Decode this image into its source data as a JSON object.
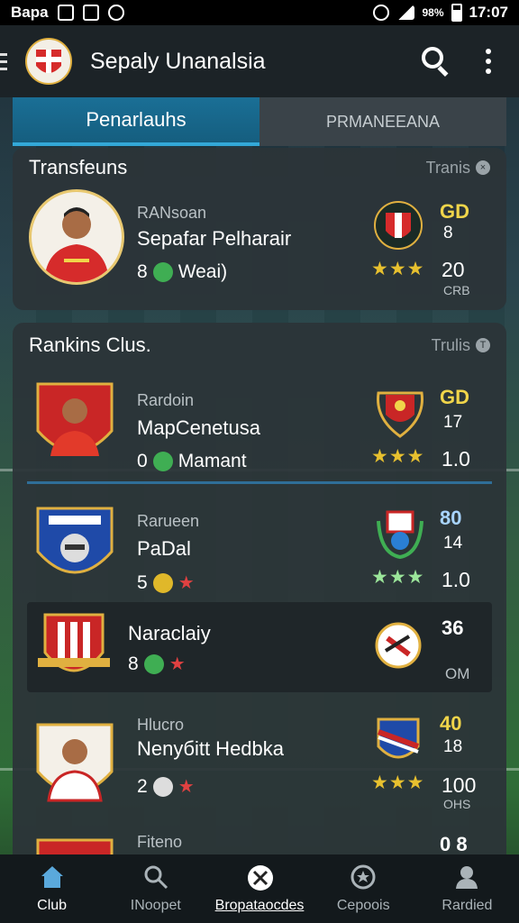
{
  "status_bar": {
    "left_text": "Bapa",
    "time": "17:07",
    "signal_text": "98%"
  },
  "app_bar": {
    "title": "Sepaly Unanalsia"
  },
  "tabs": [
    {
      "label": "Penarlauhs",
      "active": true
    },
    {
      "label": "PRMANEEANA",
      "active": false
    }
  ],
  "transfers": {
    "title": "Transfeuns",
    "trend_label": "Tranis",
    "player": {
      "sub": "RANsoan",
      "name": "Sepafar Pelharair",
      "meta_num": "8",
      "meta_label": "Weai)",
      "stat_top": "GD",
      "stat_mid": "8",
      "stat_big": "20",
      "stat_small": "CRB",
      "stars": "★★★"
    }
  },
  "ranking": {
    "title": "Rankins Clus.",
    "trend_label": "Trulis",
    "rows": [
      {
        "sub": "Rardoin",
        "name": "MapCenetusa",
        "meta_num": "0",
        "meta_label": "Mamant",
        "stat_top": "GD",
        "stat_mid": "17",
        "stat_big": "1.0",
        "stars": "★★★"
      },
      {
        "sub": "Rarueen",
        "name": "PaDal",
        "meta_num": "5",
        "meta_label": "",
        "stat_top": "80",
        "stat_mid": "14",
        "stat_big": "1.0",
        "stars": "★★★"
      },
      {
        "sub": "",
        "name": "Naraclaiy",
        "meta_num": "8",
        "meta_label": "",
        "stat_top": "36",
        "stat_mid": "",
        "stat_big": "",
        "stat_small": "OM",
        "stars": ""
      },
      {
        "sub": "Hlucro",
        "name": "Nenyбitt Hedbka",
        "meta_num": "2",
        "meta_label": "",
        "stat_top": "40",
        "stat_mid": "18",
        "stat_big": "100",
        "stat_small": "OHS",
        "stars": "★★★"
      },
      {
        "sub": "Fiteno",
        "name": "",
        "meta_num": "",
        "meta_label": "",
        "stat_top": "0 8",
        "stat_mid": "",
        "stat_big": "",
        "stars": ""
      }
    ]
  },
  "bottom_nav": [
    {
      "label": "Club",
      "icon": "home-icon"
    },
    {
      "label": "INoopet",
      "icon": "search-person-icon"
    },
    {
      "label": "Bropataocdes",
      "icon": "ball-icon"
    },
    {
      "label": "Cepoois",
      "icon": "trophy-icon"
    },
    {
      "label": "Rardied",
      "icon": "profile-icon"
    }
  ],
  "colors": {
    "accent": "#1a6f96",
    "gold": "#e7c02f",
    "red": "#d62b2b"
  }
}
